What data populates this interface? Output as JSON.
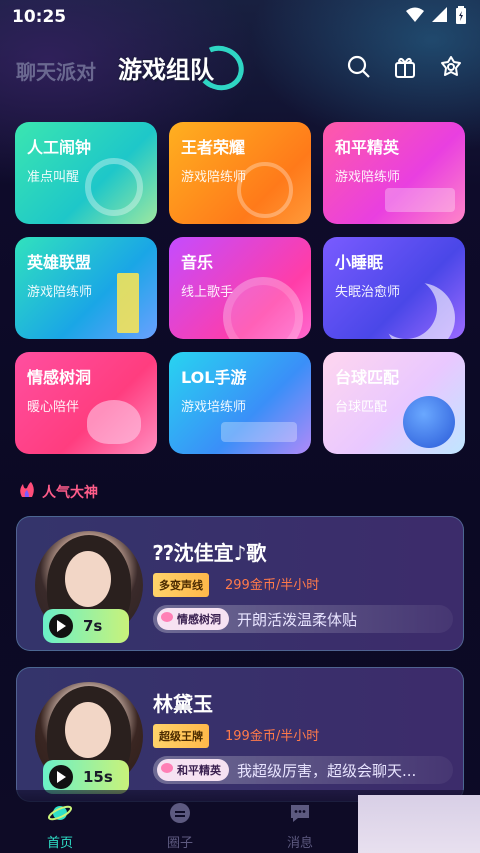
{
  "status": {
    "time": "10:25"
  },
  "header": {
    "tab_chat": "聊天派对",
    "tab_game": "游戏组队",
    "icons": [
      "search-icon",
      "gift-icon",
      "settings-flower-icon"
    ]
  },
  "categories": [
    {
      "title": "人工闹钟",
      "subtitle": "准点叫醒"
    },
    {
      "title": "王者荣耀",
      "subtitle": "游戏陪练师"
    },
    {
      "title": "和平精英",
      "subtitle": "游戏陪练师"
    },
    {
      "title": "英雄联盟",
      "subtitle": "游戏陪练师"
    },
    {
      "title": "音乐",
      "subtitle": "线上歌手"
    },
    {
      "title": "小睡眠",
      "subtitle": "失眠治愈师"
    },
    {
      "title": "情感树洞",
      "subtitle": "暖心陪伴"
    },
    {
      "title": "LOL手游",
      "subtitle": "游戏培练师"
    },
    {
      "title": "台球匹配",
      "subtitle": "台球匹配"
    }
  ],
  "section": {
    "title": "人气大神"
  },
  "users": [
    {
      "name": "⁇沈佳宜♪歌",
      "duration": "7s",
      "badge": "多变声线",
      "price": "299金币/半小时",
      "tag": "情感树洞",
      "intro": "开朗活泼温柔体贴"
    },
    {
      "name": "林黛玉",
      "duration": "15s",
      "badge": "超级王牌",
      "price": "199金币/半小时",
      "tag": "和平精英",
      "intro": "我超级厉害，超级会聊天..."
    }
  ],
  "nav": [
    {
      "label": "首页",
      "active": true
    },
    {
      "label": "圈子",
      "active": false
    },
    {
      "label": "消息",
      "active": false
    }
  ]
}
